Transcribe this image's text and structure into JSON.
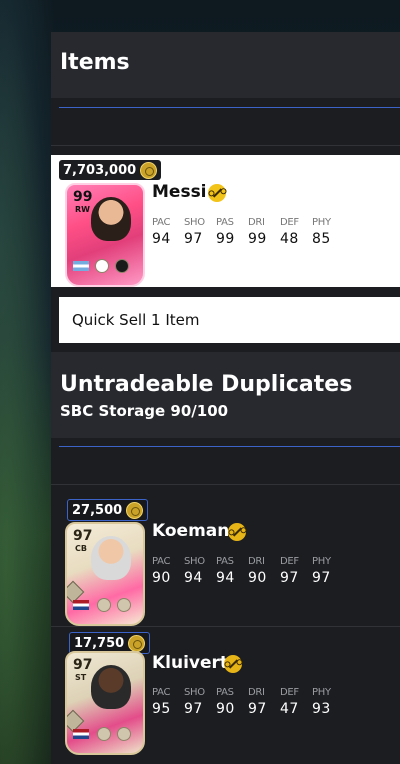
{
  "items_section": {
    "title": "Items",
    "cards": [
      {
        "price": "7,703,000",
        "rating": "99",
        "position": "RW",
        "name": "Messi",
        "stats": [
          {
            "label": "PAC",
            "value": "94"
          },
          {
            "label": "SHO",
            "value": "97"
          },
          {
            "label": "PAS",
            "value": "99"
          },
          {
            "label": "DRI",
            "value": "99"
          },
          {
            "label": "DEF",
            "value": "48"
          },
          {
            "label": "PHY",
            "value": "85"
          }
        ]
      }
    ],
    "quick_sell_label": "Quick Sell 1 Item"
  },
  "duplicates_section": {
    "title": "Untradeable Duplicates",
    "subtitle": "SBC Storage 90/100",
    "cards": [
      {
        "price": "27,500",
        "rating": "97",
        "position": "CB",
        "name": "Koeman",
        "stats": [
          {
            "label": "PAC",
            "value": "90"
          },
          {
            "label": "SHO",
            "value": "94"
          },
          {
            "label": "PAS",
            "value": "94"
          },
          {
            "label": "DRI",
            "value": "90"
          },
          {
            "label": "DEF",
            "value": "97"
          },
          {
            "label": "PHY",
            "value": "97"
          }
        ]
      },
      {
        "price": "17,750",
        "rating": "97",
        "position": "ST",
        "name": "Kluivert",
        "stats": [
          {
            "label": "PAC",
            "value": "95"
          },
          {
            "label": "SHO",
            "value": "97"
          },
          {
            "label": "PAS",
            "value": "90"
          },
          {
            "label": "DRI",
            "value": "97"
          },
          {
            "label": "DEF",
            "value": "47"
          },
          {
            "label": "PHY",
            "value": "93"
          }
        ]
      }
    ]
  },
  "colors": {
    "accent_line": "#3c64c8",
    "chemistry_badge": "#f2c318",
    "panel": "#1b1d21",
    "header": "#27292e"
  }
}
